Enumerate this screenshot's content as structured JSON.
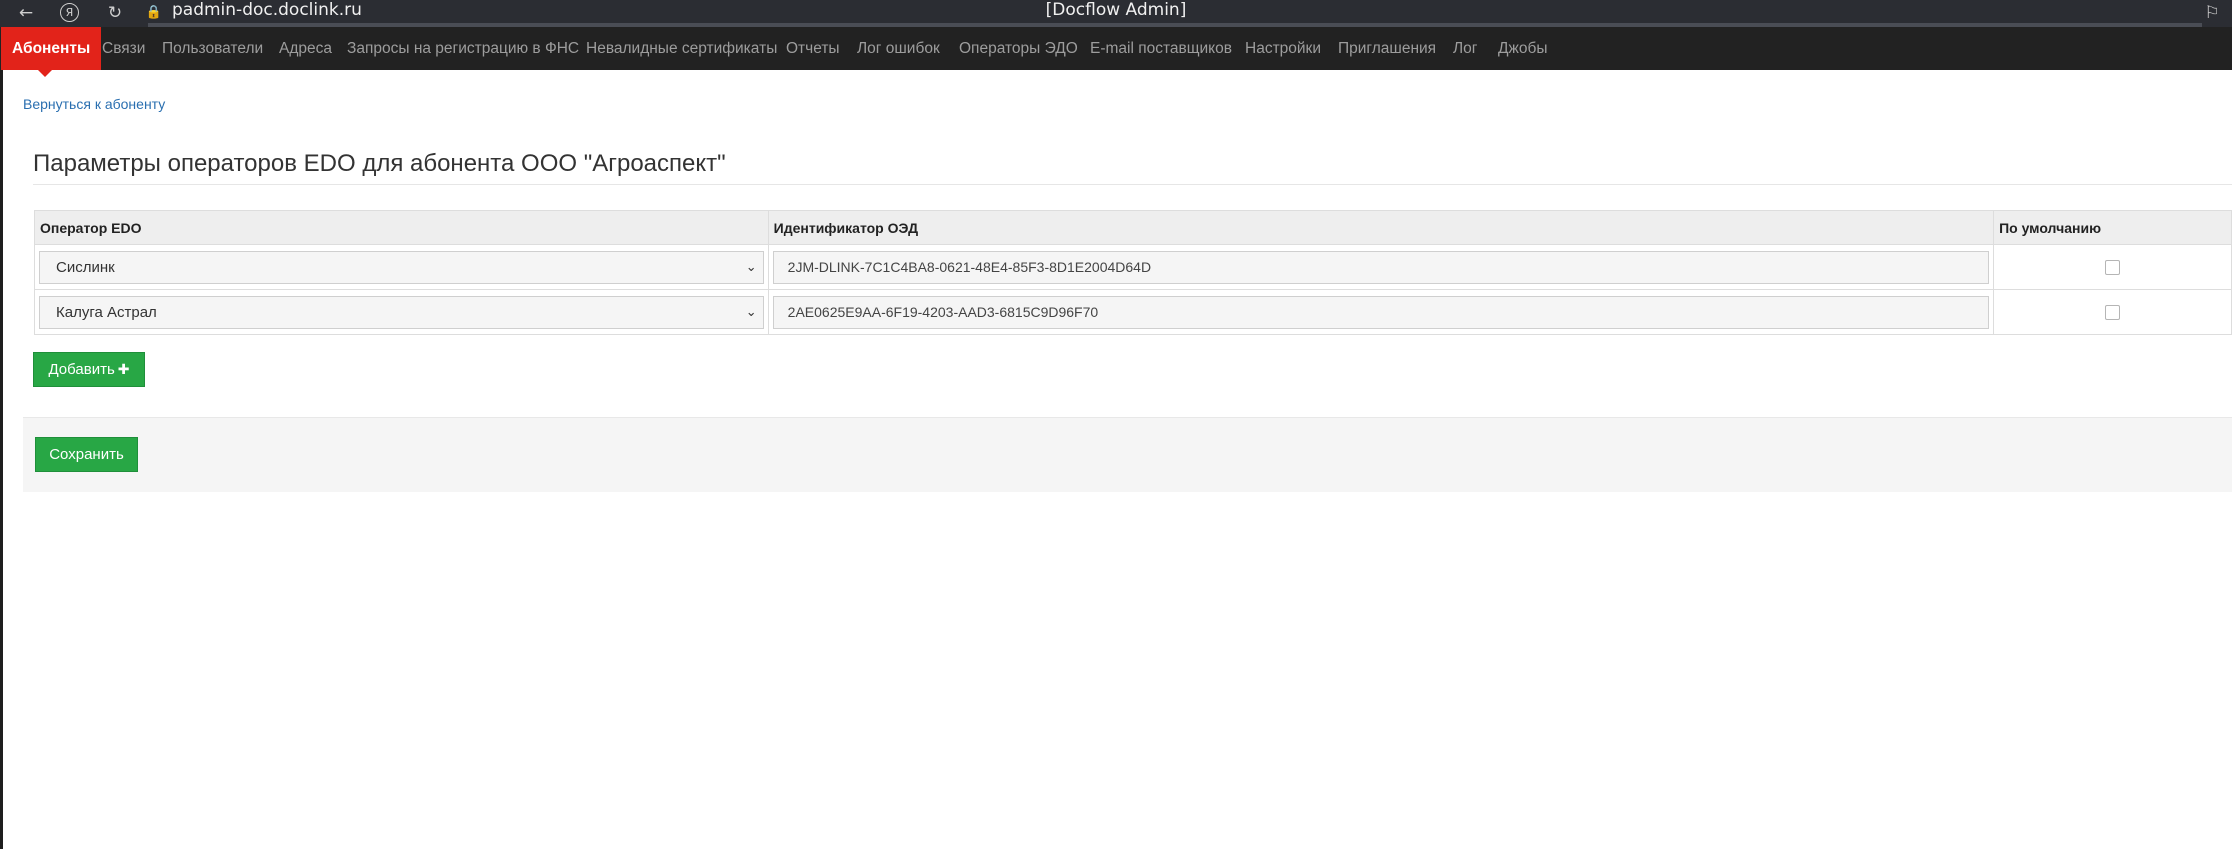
{
  "browser": {
    "url": "padmin-doc.doclink.ru",
    "window_title": "[Docflow Admin]"
  },
  "nav": {
    "items": [
      {
        "label": "Абоненты",
        "active": true
      },
      {
        "label": "Связи"
      },
      {
        "label": "Пользователи"
      },
      {
        "label": "Адреса"
      },
      {
        "label": "Запросы на регистрацию в ФНС"
      },
      {
        "label": "Невалидные сертификаты"
      },
      {
        "label": "Отчеты"
      },
      {
        "label": "Лог ошибок"
      },
      {
        "label": "Операторы ЭДО"
      },
      {
        "label": "E-mail поставщиков"
      },
      {
        "label": "Настройки"
      },
      {
        "label": "Приглашения"
      },
      {
        "label": "Лог"
      },
      {
        "label": "Джобы"
      }
    ]
  },
  "page": {
    "back_link": "Вернуться к абоненту",
    "title": "Параметры операторов EDO для абонента ООО \"Агроаспект\""
  },
  "table": {
    "headers": [
      "Оператор EDO",
      "Идентификатор ОЭД",
      "По умолчанию"
    ],
    "rows": [
      {
        "operator": "Сислинк",
        "id": "2JM-DLINK-7C1C4BA8-0621-48E4-85F3-8D1E2004D64D",
        "default": false
      },
      {
        "operator": "Калуга Астрал",
        "id": "2AE0625E9AA-6F19-4203-AAD3-6815C9D96F70",
        "default": false
      }
    ]
  },
  "buttons": {
    "add": "Добавить",
    "save": "Сохранить"
  },
  "colors": {
    "nav_bg": "#222222",
    "nav_active": "#e2231a",
    "button_green": "#28a745",
    "link": "#2a6fb0"
  }
}
